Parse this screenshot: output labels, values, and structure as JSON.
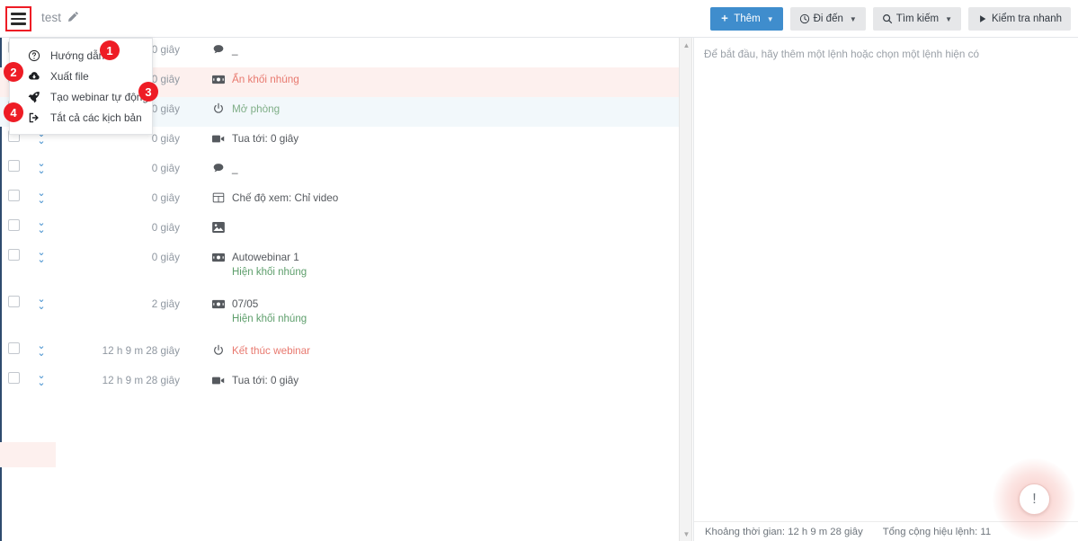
{
  "window": {
    "title": "test",
    "hamburger_icon": "hamburger-menu-icon",
    "edit_icon": "pencil-icon"
  },
  "toolbar": {
    "add_label": "Thêm",
    "goto_label": "Đi đến",
    "search_label": "Tìm kiếm",
    "quickcheck_label": "Kiểm tra nhanh",
    "primary_color": "#3f8dcd",
    "default_bg": "#e6e7e9"
  },
  "menu": {
    "items": [
      {
        "label": "Hướng dẫn",
        "icon": "question-circle-icon"
      },
      {
        "label": "Xuất file",
        "icon": "cloud-download-icon"
      },
      {
        "label": "Tạo webinar tự động",
        "icon": "rocket-icon"
      },
      {
        "label": "Tắt cả các kịch bản",
        "icon": "logout-icon"
      }
    ]
  },
  "markers": [
    {
      "label": "1"
    },
    {
      "label": "2"
    },
    {
      "label": "3"
    },
    {
      "label": "4"
    }
  ],
  "timeline": {
    "rows": [
      {
        "time": "0 giây",
        "text": "_",
        "icon": "chat-bubble-icon",
        "color": "default",
        "highlight": "none",
        "sub": null
      },
      {
        "time": "0 giây",
        "text": "Ẩn khối nhúng",
        "icon": "embed-block-icon",
        "color": "red",
        "highlight": "pink",
        "sub": null
      },
      {
        "time": "0 giây",
        "text": "Mở phòng",
        "icon": "power-icon",
        "color": "green",
        "highlight": "blue",
        "sub": null
      },
      {
        "time": "0 giây",
        "text": "Tua tới: 0 giây",
        "icon": "video-camera-icon",
        "color": "default",
        "highlight": "none",
        "sub": null
      },
      {
        "time": "0 giây",
        "text": "_",
        "icon": "chat-bubble-icon",
        "color": "default",
        "highlight": "none",
        "sub": null
      },
      {
        "time": "0 giây",
        "text": "Chế độ xem: Chỉ video",
        "icon": "grid-layout-icon",
        "color": "default",
        "highlight": "none",
        "sub": null
      },
      {
        "time": "0 giây",
        "text": "",
        "icon": "image-icon",
        "color": "default",
        "highlight": "none",
        "sub": null
      },
      {
        "time": "0 giây",
        "text": "Autowebinar 1",
        "icon": "embed-block-icon",
        "color": "default",
        "highlight": "none",
        "sub": "Hiện khối nhúng"
      },
      {
        "time": "2 giây",
        "text": "07/05",
        "icon": "embed-block-icon",
        "color": "default",
        "highlight": "none",
        "sub": "Hiện khối nhúng"
      },
      {
        "time": "12 h 9 m 28 giây",
        "text": "Kết thúc webinar",
        "icon": "power-icon",
        "color": "red",
        "highlight": "none",
        "sub": null
      },
      {
        "time": "12 h 9 m 28 giây",
        "text": "Tua tới: 0 giây",
        "icon": "video-camera-icon",
        "color": "default",
        "highlight": "none",
        "sub": null
      }
    ]
  },
  "right_panel": {
    "hint": "Để bắt đầu, hãy thêm một lệnh hoặc chọn một lệnh hiện có",
    "footer_duration": "Khoảng thời gian: 12 h 9 m 28 giây",
    "footer_total": "Tổng cộng hiệu lệnh: 11"
  },
  "fab": {
    "icon": "exclamation-icon",
    "glyph": "!"
  },
  "scrollbar": {
    "up_icon": "caret-up-icon",
    "down_icon": "caret-down-icon"
  }
}
